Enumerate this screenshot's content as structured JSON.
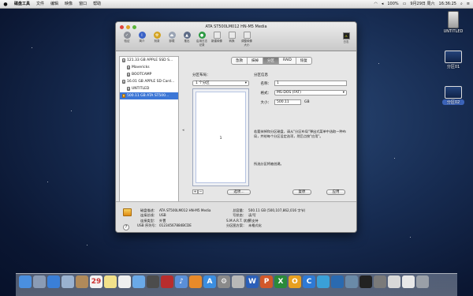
{
  "menubar": {
    "app_name": "磁盘工具",
    "items": [
      "文件",
      "编辑",
      "映像",
      "窗口",
      "帮助"
    ],
    "battery": "100%",
    "datetime": "9月29日 周六",
    "time": "16:36:25"
  },
  "desktop": {
    "icons": [
      {
        "label": "UNTITLED",
        "kind": "drive"
      },
      {
        "label": "分区01",
        "kind": "screenshot"
      },
      {
        "label": "分区02",
        "kind": "screenshot",
        "selected": true
      }
    ]
  },
  "window": {
    "title": "ATA ST500LM012 HN-M5 Media",
    "toolbar": [
      {
        "label": "验证",
        "icon": "verify-icon",
        "color": "#8b8f98",
        "glyph": "✓"
      },
      {
        "label": "简介",
        "icon": "info-icon",
        "color": "#3b63c7",
        "glyph": "i"
      },
      {
        "label": "刻录",
        "icon": "burn-icon",
        "color": "#d3a321",
        "glyph": "☢"
      },
      {
        "label": "卸载",
        "icon": "unmount-icon",
        "color": "#9aa4b4",
        "glyph": "⏏"
      },
      {
        "label": "推出",
        "icon": "eject-icon",
        "color": "#5d6b86",
        "glyph": "▲"
      },
      {
        "label": "启用日志记录",
        "icon": "journal-icon",
        "color": "#2e9a44",
        "glyph": "●"
      },
      {
        "label": "新建映像",
        "icon": "new-image-icon",
        "color": "#e9e9e9",
        "glyph": ""
      },
      {
        "label": "转换",
        "icon": "convert-icon",
        "color": "#e9e9e9",
        "glyph": ""
      },
      {
        "label": "调整映像大小",
        "icon": "resize-image-icon",
        "color": "#e9e9e9",
        "glyph": ""
      }
    ],
    "log_label": "日志",
    "sidebar": [
      {
        "label": "121.33 GB APPLE SSD S...",
        "level": 0
      },
      {
        "label": "Mavericks",
        "level": 1
      },
      {
        "label": "BOOTCAMP",
        "level": 1
      },
      {
        "label": "16.01 GB APPLE SD Card...",
        "level": 0
      },
      {
        "label": "UNTITLED",
        "level": 1
      },
      {
        "label": "500.11 GB ATA ST500...",
        "level": 0,
        "selected": true
      }
    ],
    "tabs": [
      "急救",
      "抹掉",
      "分区",
      "RAID",
      "恢复"
    ],
    "active_tab": 2,
    "partition": {
      "layout_label": "分区布局：",
      "layout_value": "1 个分区",
      "map_number": "1",
      "info_label": "分区信息",
      "name_label": "名称：",
      "name_value": "1",
      "format_label": "格式：",
      "format_value": "MS-DOS (FAT)",
      "size_label": "大小：",
      "size_value": "500.11",
      "size_unit": "GB",
      "description": "若要抹掉和分区磁盘，请从\"分区布局\"弹出式菜单中选取一种布局，并给每个分区设定选项，然后点按\"应用\"。",
      "status": "所选分区将被创建。",
      "options_button": "选项...",
      "revert_button": "复原",
      "apply_button": "应用",
      "add_symbol": "+",
      "remove_symbol": "−"
    },
    "info": {
      "col1": [
        {
          "k": "磁盘描述：",
          "v": "ATA ST500LM012 HN-M5 Media"
        },
        {
          "k": "连接总线：",
          "v": "USB"
        },
        {
          "k": "连接类型：",
          "v": "外置"
        },
        {
          "k": "USB 序列号：",
          "v": "01234567884BCDE"
        }
      ],
      "col2": [
        {
          "k": "总容量：",
          "v": "500.11 GB (500,107,862,016 字节)"
        },
        {
          "k": "写状态：",
          "v": "读/写"
        },
        {
          "k": "S.M.A.R.T. 状态：",
          "v": "不支持"
        },
        {
          "k": "分区图方案：",
          "v": "未格式化"
        }
      ],
      "help": "?"
    }
  },
  "dock": {
    "apps": [
      {
        "name": "finder-icon",
        "color": "#4a8fe0",
        "glyph": ""
      },
      {
        "name": "launchpad-icon",
        "color": "#8a9bb5",
        "glyph": ""
      },
      {
        "name": "safari-icon",
        "color": "#3a7fd8",
        "glyph": ""
      },
      {
        "name": "mail-icon",
        "color": "#9ab2d0",
        "glyph": ""
      },
      {
        "name": "contacts-icon",
        "color": "#b08a5a",
        "glyph": ""
      },
      {
        "name": "calendar-icon",
        "color": "#f2f2f2",
        "glyph": "29"
      },
      {
        "name": "notes-icon",
        "color": "#f2e18a",
        "glyph": ""
      },
      {
        "name": "reminders-icon",
        "color": "#efefef",
        "glyph": ""
      },
      {
        "name": "messages-icon",
        "color": "#6aa9e8",
        "glyph": ""
      },
      {
        "name": "facetime-icon",
        "color": "#4c4c4c",
        "glyph": ""
      },
      {
        "name": "photobooth-icon",
        "color": "#b82d2d",
        "glyph": ""
      },
      {
        "name": "itunes-icon",
        "color": "#5a8fd8",
        "glyph": "♪"
      },
      {
        "name": "ibooks-icon",
        "color": "#e88a2a",
        "glyph": ""
      },
      {
        "name": "appstore-icon",
        "color": "#3b8ee0",
        "glyph": "A"
      },
      {
        "name": "preferences-icon",
        "color": "#8a8a8a",
        "glyph": "⚙"
      },
      {
        "name": "diskutility-icon",
        "color": "#b8b8b8",
        "glyph": ""
      },
      {
        "name": "word-icon",
        "color": "#2b5fb8",
        "glyph": "W"
      },
      {
        "name": "powerpoint-icon",
        "color": "#d2582a",
        "glyph": "P"
      },
      {
        "name": "excel-icon",
        "color": "#2a8a3a",
        "glyph": "X"
      },
      {
        "name": "outlook-icon",
        "color": "#e8a020",
        "glyph": "O"
      },
      {
        "name": "lync-icon",
        "color": "#2e7ad6",
        "glyph": "C"
      },
      {
        "name": "app-blue-icon",
        "color": "#3aa0d8",
        "glyph": ""
      },
      {
        "name": "app-globe-icon",
        "color": "#2a6ab0",
        "glyph": ""
      },
      {
        "name": "app-grid-icon",
        "color": "#6a8aa8",
        "glyph": ""
      },
      {
        "name": "terminal-icon",
        "color": "#222",
        "glyph": ""
      },
      {
        "name": "app-misc-icon",
        "color": "#7a7a7a",
        "glyph": ""
      },
      {
        "name": "documents-stack-icon",
        "color": "#d8d8d8",
        "glyph": ""
      },
      {
        "name": "downloads-stack-icon",
        "color": "#e8e8e8",
        "glyph": ""
      },
      {
        "name": "trash-icon",
        "color": "#9aa0a8",
        "glyph": ""
      }
    ]
  }
}
